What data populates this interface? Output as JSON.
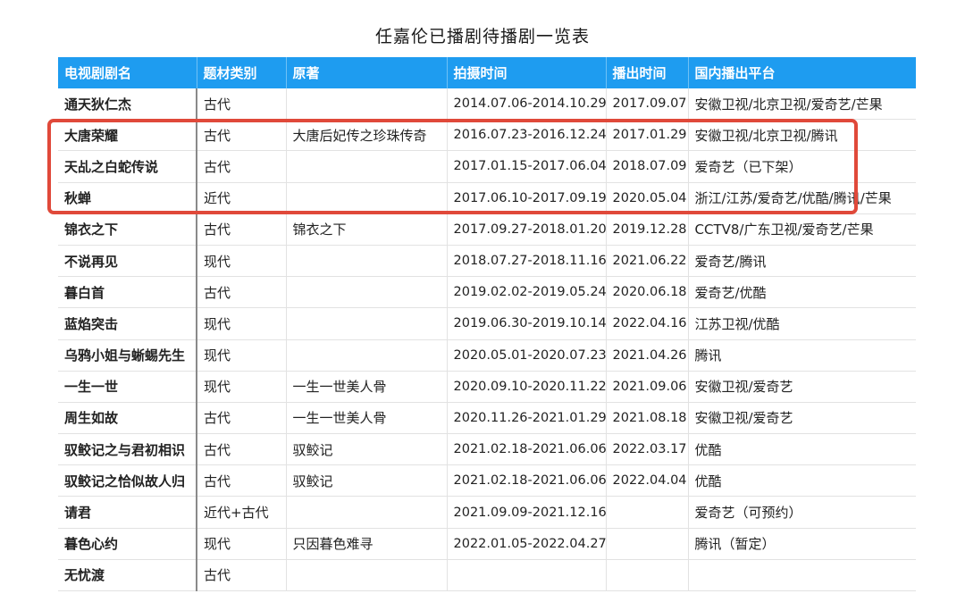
{
  "title": "任嘉伦已播剧待播剧一览表",
  "highlight_color": "#e0493a",
  "header_color": "#1e9cf0",
  "columns": [
    "电视剧剧名",
    "题材类别",
    "原著",
    "拍摄时间",
    "播出时间",
    "国内播出平台"
  ],
  "rows": [
    [
      "通天狄仁杰",
      "古代",
      "",
      "2014.07.06-2014.10.29",
      "2017.09.07",
      "安徽卫视/北京卫视/爱奇艺/芒果"
    ],
    [
      "大唐荣耀",
      "古代",
      "大唐后妃传之珍珠传奇",
      "2016.07.23-2016.12.24",
      "2017.01.29",
      "安徽卫视/北京卫视/腾讯"
    ],
    [
      "天乩之白蛇传说",
      "古代",
      "",
      "2017.01.15-2017.06.04",
      "2018.07.09",
      "爱奇艺（已下架）"
    ],
    [
      "秋蝉",
      "近代",
      "",
      "2017.06.10-2017.09.19",
      "2020.05.04",
      "浙江/江苏/爱奇艺/优酷/腾讯/芒果"
    ],
    [
      "锦衣之下",
      "古代",
      "锦衣之下",
      "2017.09.27-2018.01.20",
      "2019.12.28",
      "CCTV8/广东卫视/爱奇艺/芒果"
    ],
    [
      "不说再见",
      "现代",
      "",
      "2018.07.27-2018.11.16",
      "2021.06.22",
      "爱奇艺/腾讯"
    ],
    [
      "暮白首",
      "古代",
      "",
      "2019.02.02-2019.05.24",
      "2020.06.18",
      "爱奇艺/优酷"
    ],
    [
      "蓝焰突击",
      "现代",
      "",
      "2019.06.30-2019.10.14",
      "2022.04.16",
      "江苏卫视/优酷"
    ],
    [
      "乌鸦小姐与蜥蜴先生",
      "现代",
      "",
      "2020.05.01-2020.07.23",
      "2021.04.26",
      "腾讯"
    ],
    [
      "一生一世",
      "现代",
      "一生一世美人骨",
      "2020.09.10-2020.11.22",
      "2021.09.06",
      "安徽卫视/爱奇艺"
    ],
    [
      "周生如故",
      "古代",
      "一生一世美人骨",
      "2020.11.26-2021.01.29",
      "2021.08.18",
      "安徽卫视/爱奇艺"
    ],
    [
      "驭鲛记之与君初相识",
      "古代",
      "驭鲛记",
      "2021.02.18-2021.06.06",
      "2022.03.17",
      "优酷"
    ],
    [
      "驭鲛记之恰似故人归",
      "古代",
      "驭鲛记",
      "2021.02.18-2021.06.06",
      "2022.04.04",
      "优酷"
    ],
    [
      "请君",
      "近代+古代",
      "",
      "2021.09.09-2021.12.16",
      "",
      "爱奇艺（可预约）"
    ],
    [
      "暮色心约",
      "现代",
      "只因暮色难寻",
      "2022.01.05-2022.04.27",
      "",
      "腾讯（暂定）"
    ],
    [
      "无忧渡",
      "古代",
      "",
      "",
      "",
      ""
    ]
  ]
}
